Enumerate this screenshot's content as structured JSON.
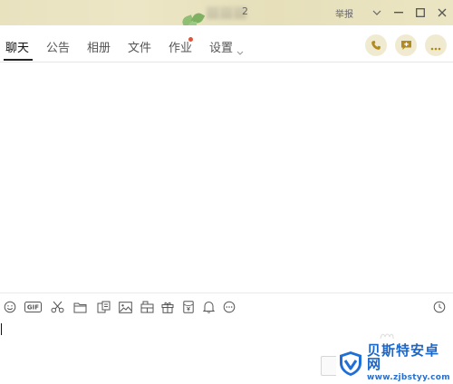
{
  "window": {
    "title_visible_tail": "2",
    "report_label": "举报",
    "controls": [
      "chevron-down-icon",
      "minimize-icon",
      "maximize-icon",
      "close-icon"
    ]
  },
  "tabs": [
    {
      "label": "聊天",
      "active": true
    },
    {
      "label": "公告",
      "active": false
    },
    {
      "label": "相册",
      "active": false
    },
    {
      "label": "文件",
      "active": false
    },
    {
      "label": "作业",
      "active": false,
      "badge_dot": true
    },
    {
      "label": "设置",
      "active": false,
      "has_dropdown": true
    }
  ],
  "header_actions": [
    "phone-icon",
    "add-message-icon",
    "more-icon"
  ],
  "input_toolbar": {
    "icons": [
      "emoji-icon",
      "gif-icon",
      "scissors-icon",
      "folder-icon",
      "doc-share-icon",
      "image-icon",
      "screen-record-icon",
      "gift-icon",
      "red-packet-icon",
      "bell-icon",
      "more-icon"
    ],
    "gif_label": "GIF",
    "right_icon": "history-clock-icon"
  },
  "watermark": {
    "text": "贝斯特安卓网",
    "url": "www.zjbstyy.com"
  },
  "colors": {
    "titlebar": "#e8e2bf",
    "action_button_bg": "#f0ebd0",
    "action_icon": "#b38a1e",
    "badge_dot": "#e0533a",
    "watermark_blue": "#1a66c9"
  }
}
